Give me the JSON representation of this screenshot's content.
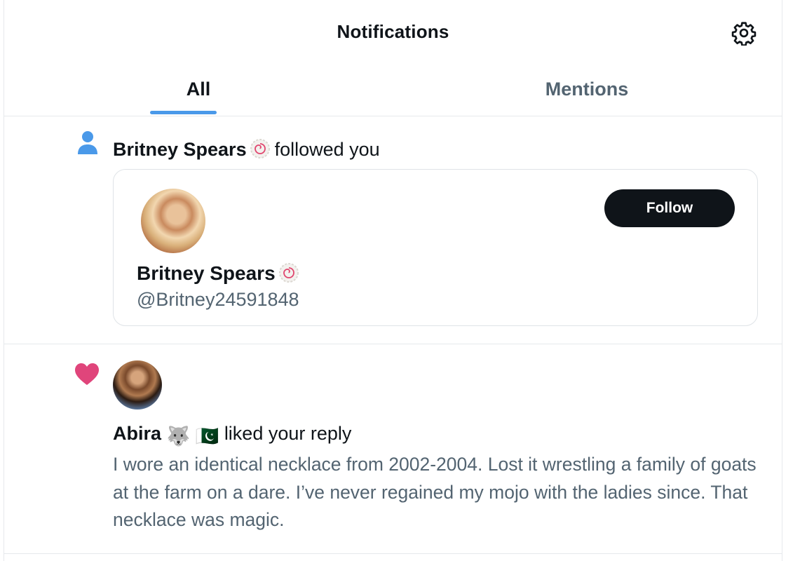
{
  "header": {
    "title": "Notifications",
    "settings_icon": "gear-icon"
  },
  "tabs": [
    {
      "label": "All",
      "active": true
    },
    {
      "label": "Mentions",
      "active": false
    }
  ],
  "notifications": [
    {
      "type": "follow",
      "icon": "person-icon",
      "actor_name": "Britney Spears",
      "action_text": "followed you",
      "card": {
        "name": "Britney Spears",
        "handle": "@Britney24591848",
        "follow_label": "Follow"
      }
    },
    {
      "type": "like",
      "icon": "heart-icon",
      "actor_name": "Abira",
      "actor_emojis": "🐺 🇵🇰",
      "action_text": "liked your reply",
      "reply_text": "I wore an identical necklace from 2002-2004.  Lost it wrestling a family of goats at the farm on a dare.  I’ve never regained my mojo with the ladies since.  That necklace was magic."
    }
  ],
  "colors": {
    "accent_blue": "#4a99e9",
    "heart_pink": "#e0457b",
    "follow_button": "#0f1419",
    "secondary_text": "#536471"
  }
}
